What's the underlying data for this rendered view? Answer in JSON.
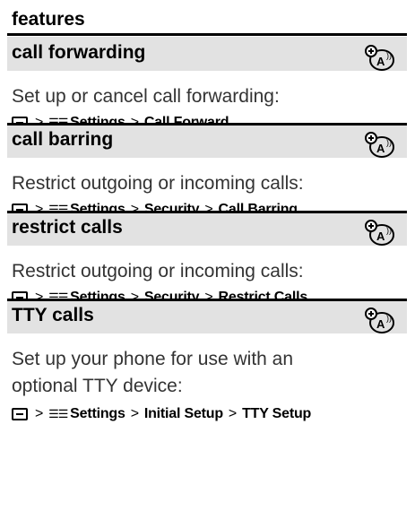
{
  "header": {
    "title": "features"
  },
  "sections": [
    {
      "title": "call forwarding",
      "description": "Set up or cancel call forwarding:",
      "path": [
        "Settings",
        "Call Forward"
      ]
    },
    {
      "title": "call barring",
      "description": "Restrict outgoing or incoming calls:",
      "path": [
        "Settings",
        "Security",
        "Call Barring"
      ]
    },
    {
      "title": "restrict calls",
      "description": "Restrict outgoing or incoming calls:",
      "path": [
        "Settings",
        "Security",
        "Restrict Calls"
      ]
    },
    {
      "title": "TTY calls",
      "description_lines": [
        "Set up your phone for use with an",
        "optional TTY device:"
      ],
      "path": [
        "Settings",
        "Initial Setup",
        "TTY Setup"
      ]
    }
  ],
  "path_separator": ">",
  "icons": {
    "menu_key": "menu-key-icon",
    "settings": "settings-icon",
    "network": "network-feature-icon"
  },
  "colors": {
    "title_row_bg": "#e2e2e2",
    "rule": "#000000",
    "text": "#333333"
  }
}
